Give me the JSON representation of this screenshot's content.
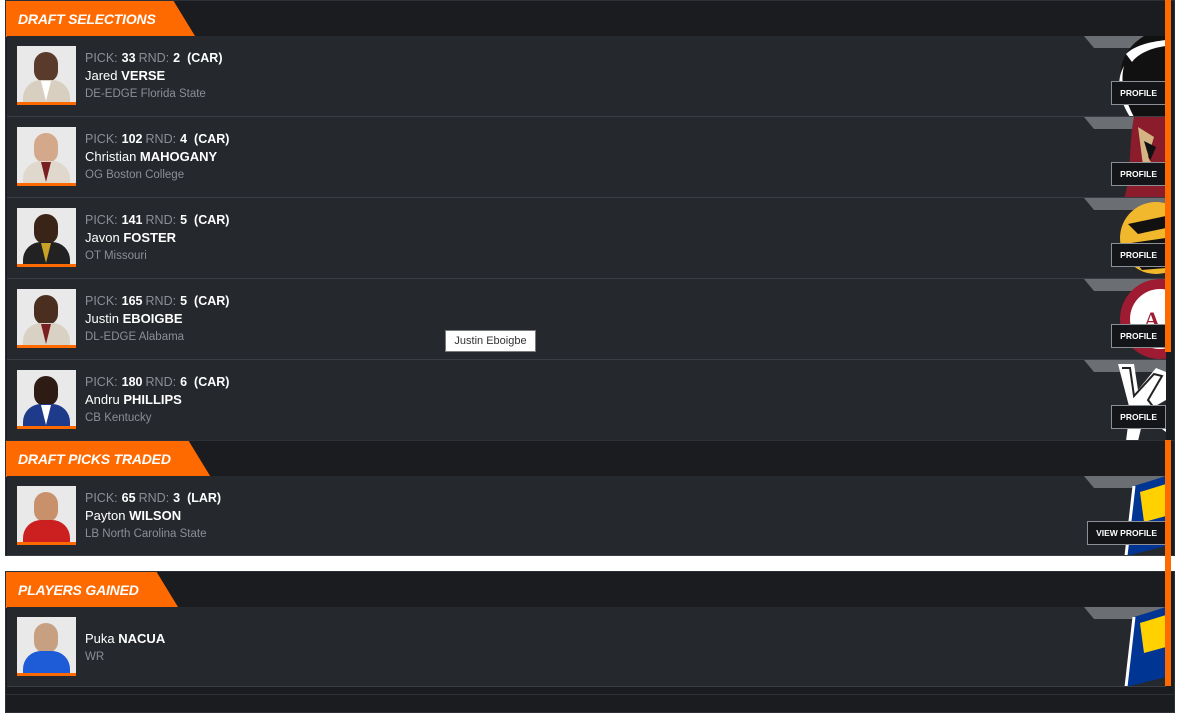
{
  "sections": {
    "draft_selections": {
      "title": "DRAFT SELECTIONS",
      "players": [
        {
          "pick": "33",
          "rnd": "2",
          "team": "(CAR)",
          "first": "Jared",
          "last": "VERSE",
          "pos": "DE-EDGE",
          "school": "Florida State",
          "button": "PROFILE"
        },
        {
          "pick": "102",
          "rnd": "4",
          "team": "(CAR)",
          "first": "Christian",
          "last": "MAHOGANY",
          "pos": "OG",
          "school": "Boston College",
          "button": "PROFILE"
        },
        {
          "pick": "141",
          "rnd": "5",
          "team": "(CAR)",
          "first": "Javon",
          "last": "FOSTER",
          "pos": "OT",
          "school": "Missouri",
          "button": "PROFILE"
        },
        {
          "pick": "165",
          "rnd": "5",
          "team": "(CAR)",
          "first": "Justin",
          "last": "EBOIGBE",
          "pos": "DL-EDGE",
          "school": "Alabama",
          "button": "PROFILE"
        },
        {
          "pick": "180",
          "rnd": "6",
          "team": "(CAR)",
          "first": "Andru",
          "last": "PHILLIPS",
          "pos": "CB",
          "school": "Kentucky",
          "button": "PROFILE"
        }
      ]
    },
    "draft_picks_traded": {
      "title": "DRAFT PICKS TRADED",
      "players": [
        {
          "pick": "65",
          "rnd": "3",
          "team": "(LAR)",
          "first": "Payton",
          "last": "WILSON",
          "pos": "LB",
          "school": "North Carolina State",
          "button": "VIEW PROFILE"
        }
      ]
    },
    "players_gained": {
      "title": "PLAYERS GAINED",
      "players": [
        {
          "first": "Puka",
          "last": "NACUA",
          "pos": "WR"
        }
      ]
    }
  },
  "labels": {
    "pick": "PICK:",
    "rnd": "RND:"
  },
  "tooltip": "Justin Eboigbe",
  "colors": {
    "accent": "#ff6a00",
    "panel": "#25282d",
    "background": "#1a1c20",
    "muted_text": "#8b8f96"
  },
  "icons": [
    "team-logo-icon",
    "player-photo"
  ]
}
